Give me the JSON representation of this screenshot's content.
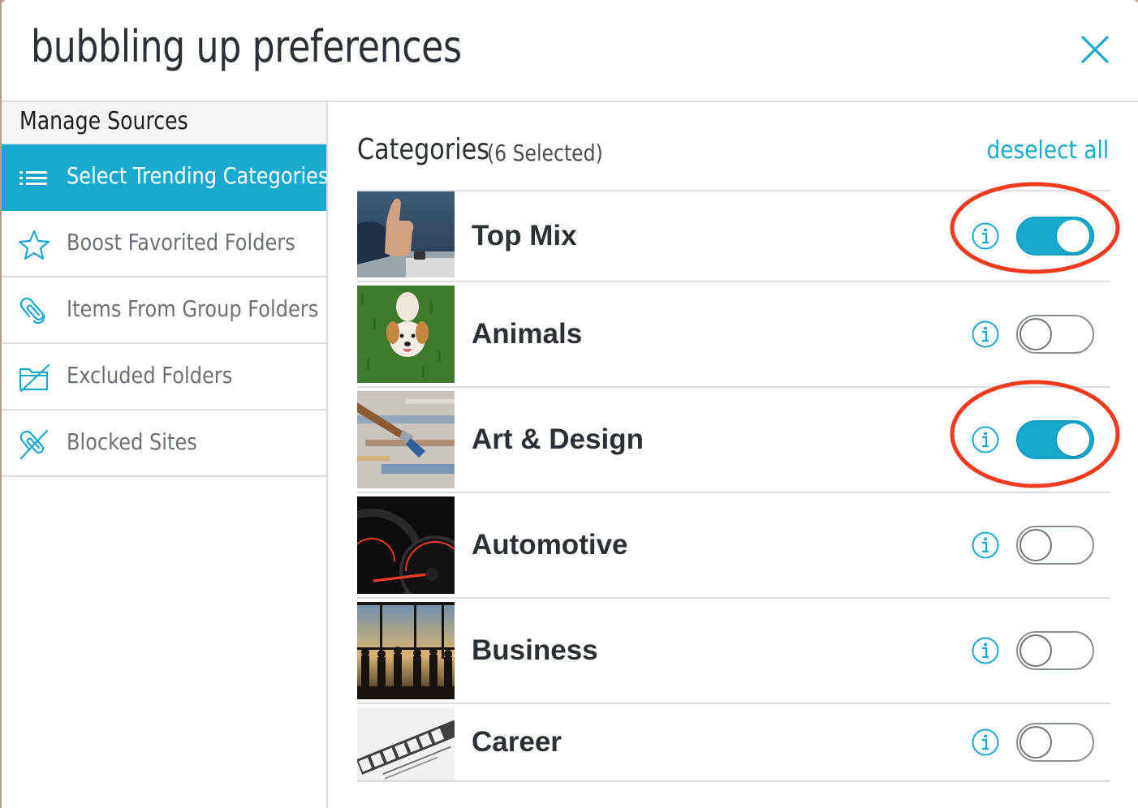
{
  "dialog": {
    "title": "bubbling up preferences",
    "close_icon": "close-icon"
  },
  "colors": {
    "accent": "#18a9cf",
    "text_dark": "#2b3036",
    "text_muted": "#6c7178",
    "divider": "#d9dde0",
    "annotation": "#f23a1f"
  },
  "sidebar": {
    "heading": "Manage Sources",
    "items": [
      {
        "label": "Select Trending Categories",
        "icon": "list-icon",
        "active": true
      },
      {
        "label": "Boost Favorited Folders",
        "icon": "star-icon",
        "active": false
      },
      {
        "label": "Items From Group Folders",
        "icon": "paperclip-icon",
        "active": false
      },
      {
        "label": "Excluded Folders",
        "icon": "folder-slash-icon",
        "active": false
      },
      {
        "label": "Blocked Sites",
        "icon": "paperclip-slash-icon",
        "active": false
      }
    ]
  },
  "main": {
    "heading": "Categories",
    "selected_count": "(6 Selected)",
    "deselect_all": "deselect all",
    "categories": [
      {
        "label": "Top Mix",
        "image": "thumbs-up-photo",
        "enabled": true
      },
      {
        "label": "Animals",
        "image": "dog-on-grass-photo",
        "enabled": false
      },
      {
        "label": "Art & Design",
        "image": "paintbrush-photo",
        "enabled": true
      },
      {
        "label": "Automotive",
        "image": "speedometer-photo",
        "enabled": false
      },
      {
        "label": "Business",
        "image": "business-people-silhouette-photo",
        "enabled": false
      },
      {
        "label": "Career",
        "image": "resume-paper-photo",
        "enabled": false
      }
    ]
  }
}
